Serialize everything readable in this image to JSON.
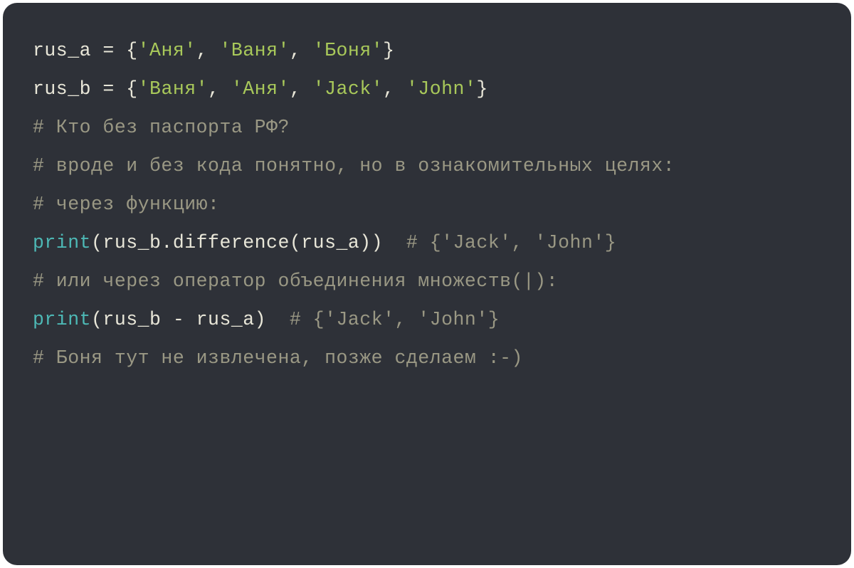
{
  "code": {
    "line1": {
      "var": "rus_a",
      "op": " = ",
      "brace_open": "{",
      "s1": "'Аня'",
      "c1": ", ",
      "s2": "'Ваня'",
      "c2": ", ",
      "s3": "'Боня'",
      "brace_close": "}"
    },
    "line2": {
      "var": "rus_b",
      "op": " = ",
      "brace_open": "{",
      "s1": "'Ваня'",
      "c1": ", ",
      "s2": "'Аня'",
      "c2": ", ",
      "s3": "'Jack'",
      "c3": ", ",
      "s4": "'John'",
      "brace_close": "}"
    },
    "line3": "",
    "line4": "# Кто без паспорта РФ?",
    "line5": "# вроде и без кода понятно, но в ознакомительных целях:",
    "line6": "",
    "line7": "# через функцию:",
    "line8": {
      "func": "print",
      "paren_open": "(",
      "arg": "rus_b.difference(rus_a)",
      "paren_close": ")",
      "pad": "  ",
      "comment": "# {'Jack', 'John'}"
    },
    "line9": "",
    "line10": "# или через оператор объединения множеств(|):",
    "line11": {
      "func": "print",
      "paren_open": "(",
      "arg": "rus_b - rus_a",
      "paren_close": ")",
      "pad": "  ",
      "comment": "# {'Jack', 'John'}"
    },
    "line12": "",
    "line13": "# Боня тут не извлечена, позже сделаем :-)"
  }
}
